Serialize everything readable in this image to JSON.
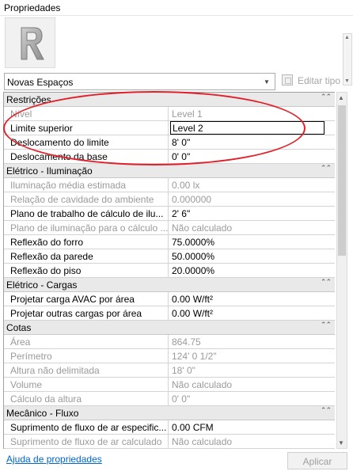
{
  "window": {
    "title": "Propriedades"
  },
  "type_selector": {
    "value": "Novas Espaços",
    "edit_type_label": "Editar tipo"
  },
  "groups": [
    {
      "name": "Restrições",
      "rows": [
        {
          "label": "Nível",
          "value": "Level 1",
          "readonly": true
        },
        {
          "label": "Limite superior",
          "value": "Level 2",
          "readonly": false,
          "editing": true
        },
        {
          "label": "Deslocamento do limite",
          "value": "8'  0\"",
          "readonly": false
        },
        {
          "label": "Deslocamento da base",
          "value": "0'  0\"",
          "readonly": false
        }
      ]
    },
    {
      "name": "Elétrico - Iluminação",
      "rows": [
        {
          "label": "Iluminação média estimada",
          "value": "0.00 lx",
          "readonly": true
        },
        {
          "label": "Relação de cavidade do ambiente",
          "value": "0.000000",
          "readonly": true
        },
        {
          "label": "Plano de trabalho de cálculo de ilu...",
          "value": "2'  6\"",
          "readonly": false
        },
        {
          "label": "Plano de iluminação para o cálculo ...",
          "value": "Não calculado",
          "readonly": true
        },
        {
          "label": "Reflexão do forro",
          "value": "75.0000%",
          "readonly": false
        },
        {
          "label": "Reflexão da parede",
          "value": "50.0000%",
          "readonly": false
        },
        {
          "label": "Reflexão do piso",
          "value": "20.0000%",
          "readonly": false
        }
      ]
    },
    {
      "name": "Elétrico - Cargas",
      "rows": [
        {
          "label": "Projetar carga AVAC por área",
          "value": "0.00 W/ft²",
          "readonly": false
        },
        {
          "label": "Projetar outras cargas por área",
          "value": "0.00 W/ft²",
          "readonly": false
        }
      ]
    },
    {
      "name": "Cotas",
      "rows": [
        {
          "label": "Área",
          "value": "864.75",
          "readonly": true
        },
        {
          "label": "Perímetro",
          "value": "124'  0 1/2\"",
          "readonly": true
        },
        {
          "label": "Altura não delimitada",
          "value": "18'  0\"",
          "readonly": true
        },
        {
          "label": "Volume",
          "value": "Não calculado",
          "readonly": true
        },
        {
          "label": "Cálculo da altura",
          "value": "0'  0\"",
          "readonly": true
        }
      ]
    },
    {
      "name": "Mecânico - Fluxo",
      "rows": [
        {
          "label": "Suprimento de fluxo de ar especific...",
          "value": "0.00 CFM",
          "readonly": false
        },
        {
          "label": "Suprimento de fluxo de ar calculado",
          "value": "Não calculado",
          "readonly": true
        }
      ]
    }
  ],
  "footer": {
    "help_link": "Ajuda de propriedades",
    "apply_label": "Aplicar"
  },
  "colors": {
    "annotation": "#e2202a",
    "link": "#0066cc",
    "group_header_bg": "#e9e9e9"
  }
}
